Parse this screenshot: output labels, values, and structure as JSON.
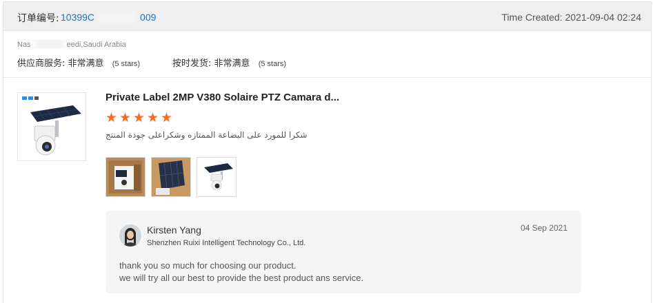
{
  "order": {
    "label": "订单编号:",
    "number_prefix": "10399C",
    "number_suffix": "009",
    "time_created": "Time Created: 2021-09-04 02:24"
  },
  "buyer": {
    "location_prefix": "Nas",
    "location_suffix": "eedi,Saudi Arabia"
  },
  "ratings": [
    {
      "label": "供应商服务:",
      "value": "非常满意",
      "stars": "(5 stars)"
    },
    {
      "label": "按时发货:",
      "value": "非常满意",
      "stars": "(5 stars)"
    }
  ],
  "product": {
    "title": "Private Label 2MP V380 Solaire PTZ Camara d...",
    "rating_stars": 5,
    "review_text": "شكرا للمورد على البضاعة الممتازه وشكراعلى جودة المنتج",
    "icons": {
      "star": "star-icon",
      "thumb": "solar-camera-image"
    }
  },
  "reply": {
    "name": "Kirsten Yang",
    "company": "Shenzhen Ruixi Intelligent Technology Co., Ltd.",
    "date": "04 Sep 2021",
    "line1": "thank you so much for choosing our product.",
    "line2": "we will try all our best to provide the best product ans service."
  },
  "colors": {
    "accent_star": "#f56a1e",
    "link_blue": "#1a73c7",
    "header_bg": "#efefef"
  }
}
